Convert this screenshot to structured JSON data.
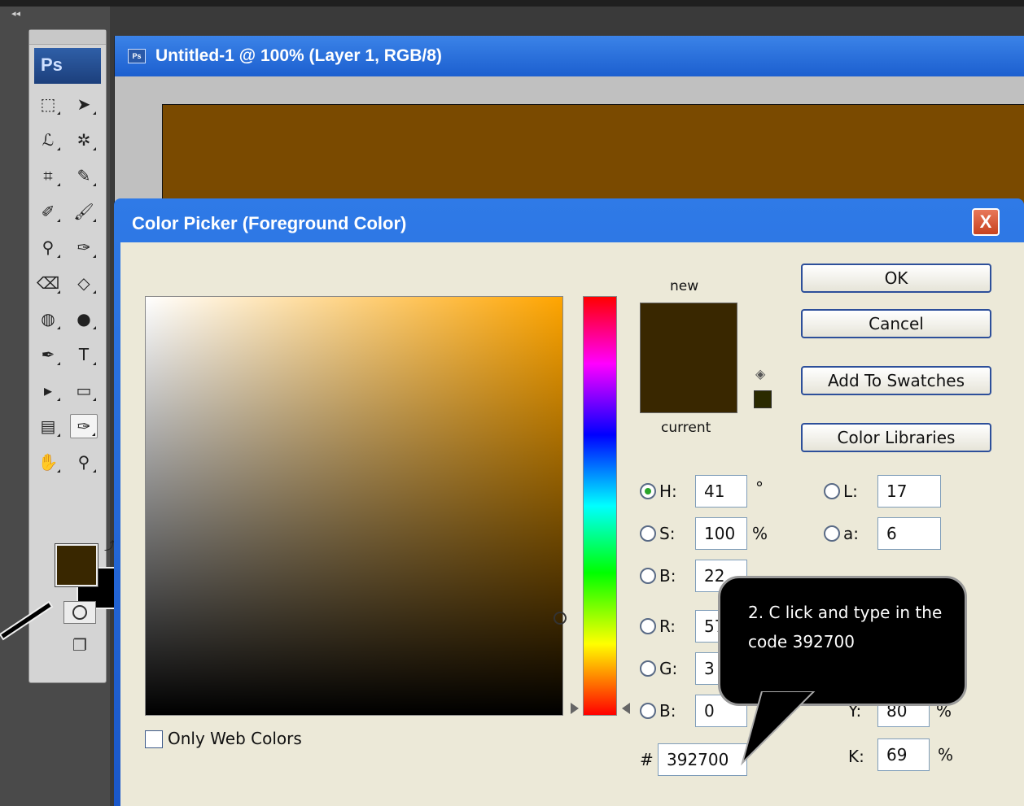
{
  "toolbar": {
    "collapse": "◂◂",
    "logo": "Ps"
  },
  "tools": [
    {
      "name": "marquee-tool",
      "glyph": "⬚"
    },
    {
      "name": "move-tool",
      "glyph": "➤"
    },
    {
      "name": "lasso-tool",
      "glyph": "ℒ"
    },
    {
      "name": "magic-wand-tool",
      "glyph": "✲"
    },
    {
      "name": "crop-tool",
      "glyph": "⌗"
    },
    {
      "name": "slice-tool",
      "glyph": "✎"
    },
    {
      "name": "healing-brush-tool",
      "glyph": "✐"
    },
    {
      "name": "brush-tool",
      "glyph": "🖌"
    },
    {
      "name": "clone-stamp-tool",
      "glyph": "⚲"
    },
    {
      "name": "history-brush-tool",
      "glyph": "✑"
    },
    {
      "name": "eraser-tool",
      "glyph": "⌫"
    },
    {
      "name": "paint-bucket-tool",
      "glyph": "◇"
    },
    {
      "name": "blur-tool",
      "glyph": "◍"
    },
    {
      "name": "dodge-tool",
      "glyph": "●"
    },
    {
      "name": "pen-tool",
      "glyph": "✒"
    },
    {
      "name": "type-tool",
      "glyph": "T"
    },
    {
      "name": "path-selection-tool",
      "glyph": "▸"
    },
    {
      "name": "rectangle-tool",
      "glyph": "▭"
    },
    {
      "name": "notes-tool",
      "glyph": "▤"
    },
    {
      "name": "eyedropper-tool",
      "glyph": "✑"
    },
    {
      "name": "hand-tool",
      "glyph": "✋"
    },
    {
      "name": "zoom-tool",
      "glyph": "⚲"
    }
  ],
  "document": {
    "title": "Untitled-1 @ 100% (Layer 1, RGB/8)",
    "canvas_color": "#7a4a00"
  },
  "dialog": {
    "title": "Color Picker (Foreground Color)",
    "close": "X",
    "new_label": "new",
    "current_label": "current",
    "buttons": {
      "ok": "OK",
      "cancel": "Cancel",
      "add_to_swatches": "Add To Swatches",
      "color_libraries": "Color Libraries"
    },
    "hsb": {
      "h": {
        "label": "H:",
        "value": "41",
        "unit": "°",
        "selected": true
      },
      "s": {
        "label": "S:",
        "value": "100",
        "unit": "%"
      },
      "b": {
        "label": "B:",
        "value": "22"
      }
    },
    "rgb": {
      "r": {
        "label": "R:",
        "value": "57"
      },
      "g": {
        "label": "G:",
        "value": "3"
      },
      "b": {
        "label": "B:",
        "value": "0"
      }
    },
    "lab": {
      "l": {
        "label": "L:",
        "value": "17"
      },
      "a": {
        "label": "a:",
        "value": "6"
      }
    },
    "cmyk": {
      "y": {
        "label": "Y:",
        "value": "80",
        "unit": "%"
      },
      "k": {
        "label": "K:",
        "value": "69",
        "unit": "%"
      }
    },
    "hex": {
      "label": "#",
      "value": "392700"
    },
    "only_web_colors": "Only Web Colors",
    "new_color": "#392700",
    "current_color": "#392700"
  },
  "callout": {
    "text": "2. C lick and type in the code 392700"
  }
}
